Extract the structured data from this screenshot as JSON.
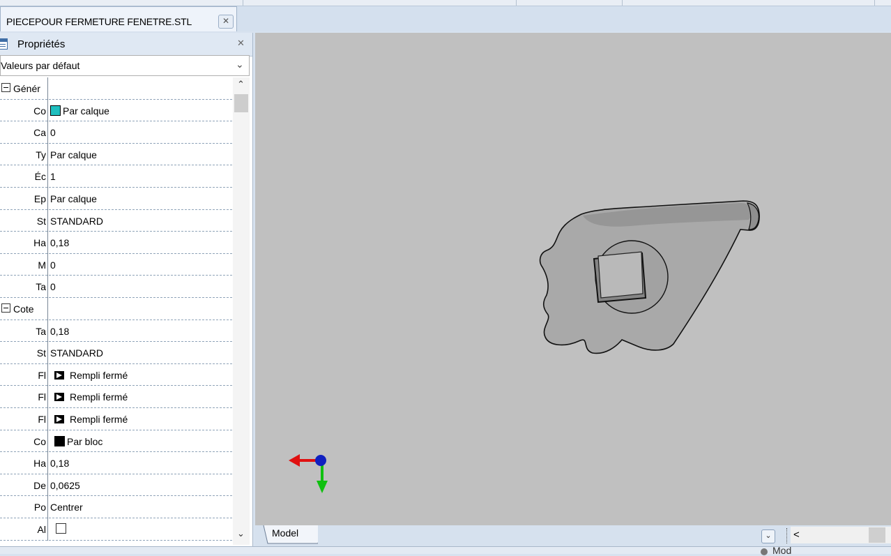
{
  "document_tab": {
    "title": "PIECEPOUR FERMETURE FENETRE.STL",
    "close_icon": "close-icon"
  },
  "properties_panel": {
    "title": "Propriétés",
    "dropdown_value": "Valeurs par défaut",
    "categories": [
      {
        "label": "Génér",
        "rows": [
          {
            "name": "Co",
            "value": "Par calque",
            "swatch": "#1fbfbf"
          },
          {
            "name": "Ca",
            "value": "0"
          },
          {
            "name": "Ty",
            "value": "Par calque"
          },
          {
            "name": "Éc",
            "value": "1"
          },
          {
            "name": "Ep",
            "value": "Par calque"
          },
          {
            "name": "St",
            "value": "STANDARD"
          },
          {
            "name": "Ha",
            "value": "0,18"
          },
          {
            "name": "M",
            "value": "0"
          },
          {
            "name": "Ta",
            "value": "0"
          }
        ]
      },
      {
        "label": "Cote",
        "rows": [
          {
            "name": "Ta",
            "value": "0,18"
          },
          {
            "name": "St",
            "value": "STANDARD"
          },
          {
            "name": "Fl",
            "value": "Rempli fermé",
            "arrow": true
          },
          {
            "name": "Fl",
            "value": "Rempli fermé",
            "arrow": true
          },
          {
            "name": "Fl",
            "value": "Rempli fermé",
            "arrow": true
          },
          {
            "name": "Co",
            "value": "Par bloc",
            "swatch": "#000000"
          },
          {
            "name": "Ha",
            "value": "0,18"
          },
          {
            "name": "De",
            "value": "0,0625"
          },
          {
            "name": "Po",
            "value": "Centrer"
          },
          {
            "name": "Al",
            "value": "",
            "checkbox": true
          }
        ]
      }
    ]
  },
  "viewport": {
    "background": "#c0c0c0",
    "axis_colors": {
      "x": "#e01010",
      "y": "#10c010",
      "z": "#1020c0"
    }
  },
  "layout_tabs": {
    "active": "Model"
  },
  "status": {
    "text": "Mod"
  }
}
